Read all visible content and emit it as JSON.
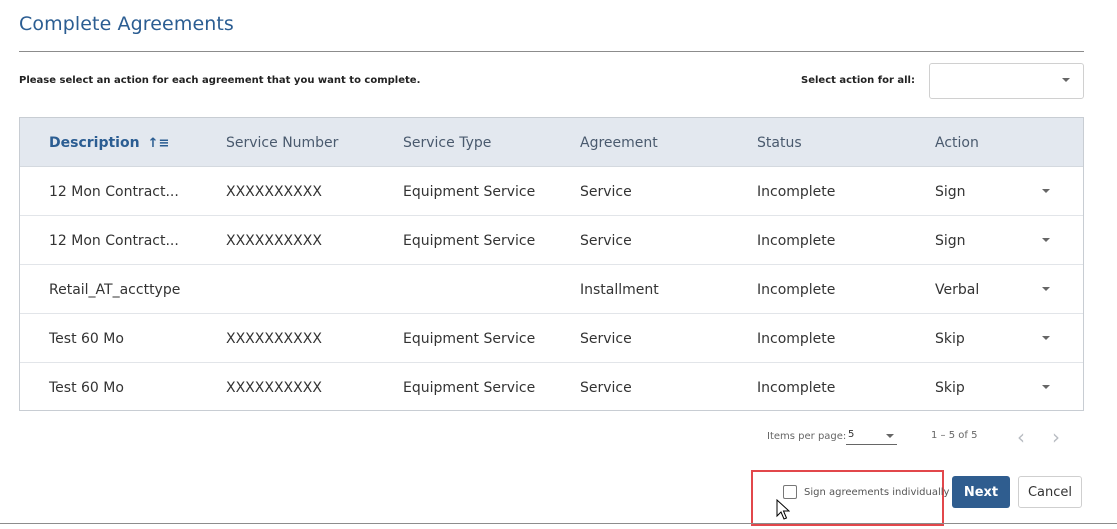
{
  "page": {
    "title": "Complete Agreements",
    "instruction": "Please select an action for each agreement that you want to complete.",
    "select_all_label": "Select action for all:",
    "select_all_value": ""
  },
  "table": {
    "columns": [
      "Description",
      "Service Number",
      "Service Type",
      "Agreement",
      "Status",
      "Action"
    ],
    "sorted_column": "Description",
    "rows": [
      {
        "description": "12 Mon Contract...",
        "service_number": "XXXXXXXXXX",
        "service_type": "Equipment Service",
        "agreement": "Service",
        "status": "Incomplete",
        "action": "Sign"
      },
      {
        "description": "12 Mon Contract...",
        "service_number": "XXXXXXXXXX",
        "service_type": "Equipment Service",
        "agreement": "Service",
        "status": "Incomplete",
        "action": "Sign"
      },
      {
        "description": "Retail_AT_accttype",
        "service_number": "",
        "service_type": "",
        "agreement": "Installment",
        "status": "Incomplete",
        "action": "Verbal"
      },
      {
        "description": "Test 60 Mo",
        "service_number": "XXXXXXXXXX",
        "service_type": "Equipment Service",
        "agreement": "Service",
        "status": "Incomplete",
        "action": "Skip"
      },
      {
        "description": "Test 60 Mo",
        "service_number": "XXXXXXXXXX",
        "service_type": "Equipment Service",
        "agreement": "Service",
        "status": "Incomplete",
        "action": "Skip"
      }
    ]
  },
  "pagination": {
    "items_per_page_label": "Items per page:",
    "items_per_page": "5",
    "range": "1 – 5 of 5",
    "prev_icon": "chevron-left-icon",
    "next_icon": "chevron-right-icon"
  },
  "footer": {
    "checkbox_label": "Sign agreements individually",
    "checkbox_checked": false,
    "next_label": "Next",
    "cancel_label": "Cancel"
  },
  "colors": {
    "accent": "#2f5d8f",
    "title": "#2b5d92",
    "header_bg": "#e3e8ef",
    "highlight": "#e2474b"
  }
}
